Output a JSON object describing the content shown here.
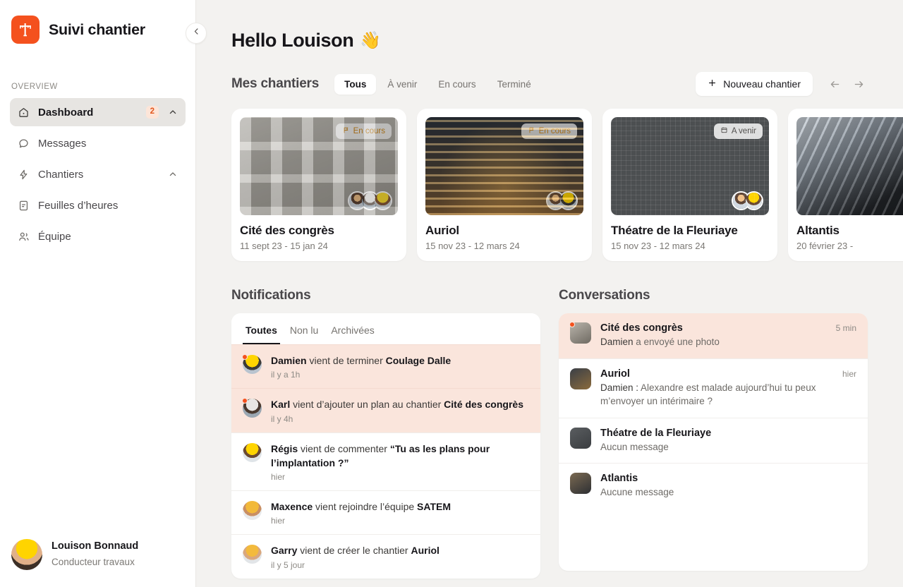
{
  "app": {
    "brand_title": "Suivi chantier",
    "logo_icon": "crane-tower-icon",
    "accent_color": "#f4511e",
    "background_color": "#f3f2f0",
    "collapse_icon": "chevron-left-icon"
  },
  "sidebar": {
    "section_label": "OVERVIEW",
    "items": [
      {
        "label": "Dashboard",
        "icon": "home-icon",
        "badge": "2",
        "chevron": "chevron-up-icon",
        "active": true
      },
      {
        "label": "Messages",
        "icon": "chat-icon",
        "badge": null,
        "chevron": null,
        "active": false
      },
      {
        "label": "Chantiers",
        "icon": "bolt-icon",
        "badge": null,
        "chevron": "chevron-up-icon",
        "active": false
      },
      {
        "label": "Feuilles d’heures",
        "icon": "document-icon",
        "badge": null,
        "chevron": null,
        "active": false
      },
      {
        "label": "Équipe",
        "icon": "users-icon",
        "badge": null,
        "chevron": null,
        "active": false
      }
    ],
    "user": {
      "name": "Louison Bonnaud",
      "role": "Conducteur travaux",
      "avatar": "user-avatar"
    }
  },
  "header": {
    "greeting": "Hello Louison",
    "greeting_emoji": "👋"
  },
  "projects_section": {
    "title": "Mes chantiers",
    "tabs": [
      {
        "label": "Tous",
        "active": true
      },
      {
        "label": "À venir",
        "active": false
      },
      {
        "label": "En cours",
        "active": false
      },
      {
        "label": "Terminé",
        "active": false
      }
    ],
    "new_button": {
      "label": "Nouveau chantier",
      "icon": "plus-icon"
    },
    "nav_prev_icon": "arrow-left-icon",
    "nav_next_icon": "arrow-right-icon",
    "cards": [
      {
        "name": "Cité des congrès",
        "dates": "11 sept 23 - 15 jan 24",
        "status": "En cours",
        "status_icon": "flag-icon",
        "status_type": "encours",
        "photo_class": "ph1",
        "avatars": [
          "f-a",
          "f-c",
          "f-f"
        ]
      },
      {
        "name": "Auriol",
        "dates": "15 nov 23 - 12 mars 24",
        "status": "En cours",
        "status_icon": "flag-icon",
        "status_type": "encours",
        "photo_class": "ph2",
        "avatars": [
          "f-a",
          "f-b"
        ]
      },
      {
        "name": "Théatre de la Fleuriaye",
        "dates": "15 nov 23 - 12 mars 24",
        "status": "A venir",
        "status_icon": "calendar-icon",
        "status_type": "avenir",
        "photo_class": "ph3",
        "avatars": [
          "f-a",
          "f-e"
        ]
      },
      {
        "name": "Altantis",
        "dates": "20 février 23 -",
        "status": "",
        "status_icon": "",
        "status_type": "none",
        "photo_class": "ph4",
        "avatars": []
      }
    ]
  },
  "notifications": {
    "title": "Notifications",
    "tabs": [
      {
        "label": "Toutes",
        "active": true
      },
      {
        "label": "Non lu",
        "active": false
      },
      {
        "label": "Archivées",
        "active": false
      }
    ],
    "items": [
      {
        "actor": "Damien",
        "text": " vient de terminer ",
        "target": "Coulage Dalle",
        "time": "il y a 1h",
        "unread": true,
        "avatar": "f-b"
      },
      {
        "actor": "Karl",
        "text": " vient d’ajouter un plan au chantier ",
        "target": "Cité des congrès",
        "time": "il y 4h",
        "unread": true,
        "avatar": "f-c"
      },
      {
        "actor": "Régis",
        "text": " vient de commenter ",
        "target": "“Tu as les plans pour l’implantation ?”",
        "time": "hier",
        "unread": false,
        "avatar": "f-e"
      },
      {
        "actor": "Maxence",
        "text": " vient rejoindre l’équipe ",
        "target": "SATEM",
        "time": "hier",
        "unread": false,
        "avatar": "f-g"
      },
      {
        "actor": "Garry",
        "text": " vient de créer le chantier ",
        "target": "Auriol",
        "time": "il y 5 jour",
        "unread": false,
        "avatar": "f-d"
      }
    ]
  },
  "conversations": {
    "title": "Conversations",
    "items": [
      {
        "name": "Cité des congrès",
        "message_author": "Damien",
        "message": " a envoyé une photo",
        "time": "5 min",
        "unread": true,
        "thumb": "thumb-a"
      },
      {
        "name": "Auriol",
        "message_author": "Damien :",
        "message": " Alexandre est malade aujourd’hui tu peux m’envoyer un intérimaire ?",
        "time": "hier",
        "unread": false,
        "thumb": "thumb-b"
      },
      {
        "name": "Théatre de la Fleuriaye",
        "message_author": "",
        "message": "Aucun message",
        "time": "",
        "unread": false,
        "thumb": "thumb-c"
      },
      {
        "name": "Atlantis",
        "message_author": "",
        "message": "Aucune message",
        "time": "",
        "unread": false,
        "thumb": "thumb-d"
      }
    ]
  }
}
